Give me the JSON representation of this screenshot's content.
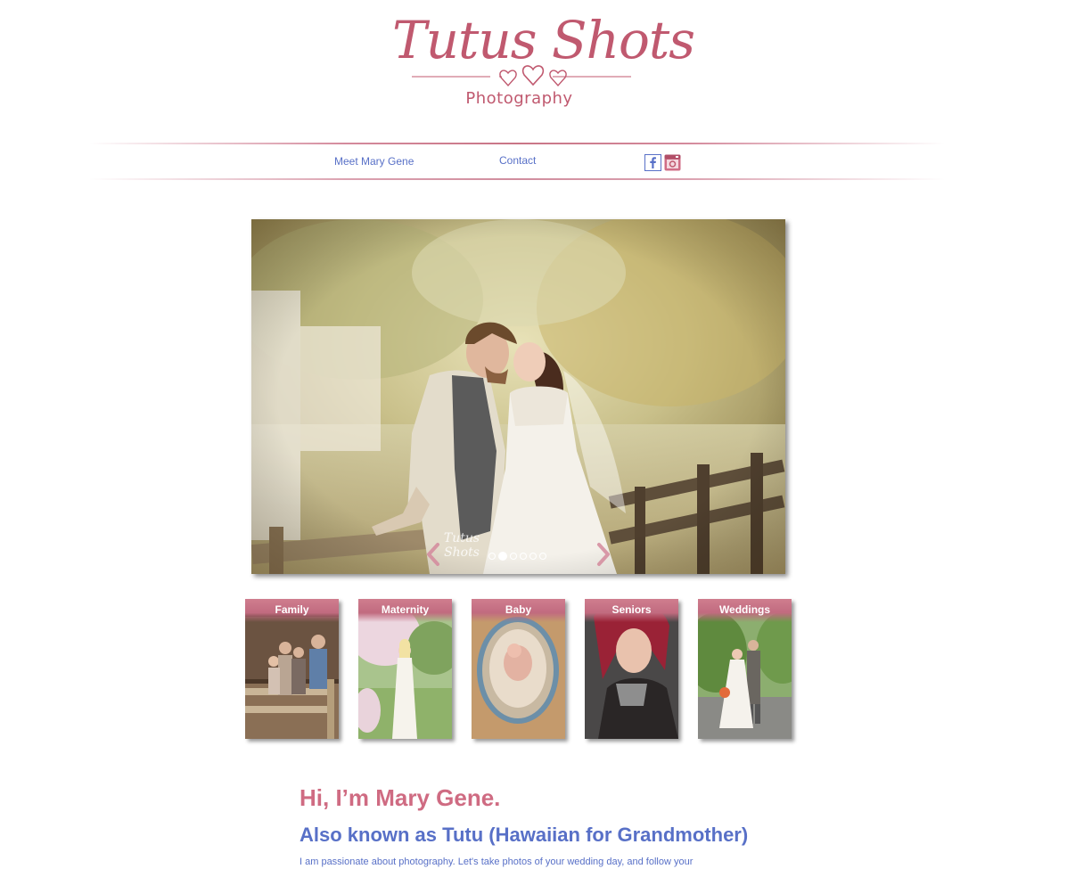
{
  "logo": {
    "title": "Tutus Shots",
    "subtitle": "Photography"
  },
  "nav": {
    "links": [
      {
        "label": "Meet Mary Gene"
      },
      {
        "label": "Contact"
      }
    ],
    "social": [
      {
        "icon": "facebook-icon"
      },
      {
        "icon": "instagram-icon"
      }
    ]
  },
  "slideshow": {
    "watermark": "Tutus Shots",
    "slide_count": 6,
    "active_slide": 2
  },
  "categories": [
    {
      "label": "Family"
    },
    {
      "label": "Maternity"
    },
    {
      "label": "Baby"
    },
    {
      "label": "Seniors"
    },
    {
      "label": "Weddings"
    }
  ],
  "intro": {
    "heading": "Hi, I’m Mary Gene.",
    "subheading": "Also known as Tutu (Hawaiian for Grandmother)",
    "body": "I am passionate about photography. Let's take photos of your wedding day, and follow your"
  },
  "colors": {
    "brand_pink": "#c0596f",
    "link_blue": "#5870c7"
  }
}
